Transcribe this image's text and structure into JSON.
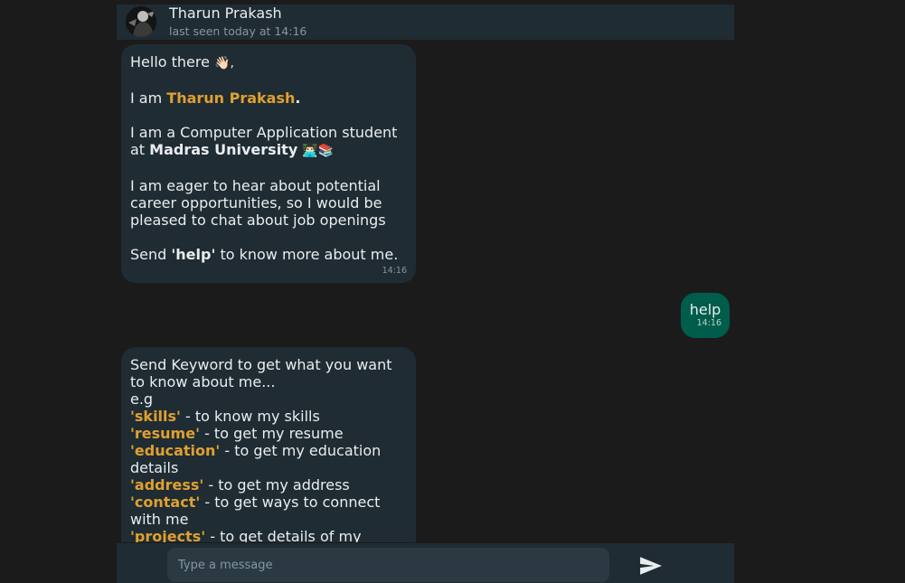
{
  "header": {
    "name": "Tharun Prakash",
    "status": "last seen today at 14:16"
  },
  "messages": {
    "intro": {
      "greeting": "Hello there",
      "greeting_emoji": "👋🏻,",
      "iam_prefix": "I am ",
      "iam_name": "Tharun Prakash",
      "iam_suffix": ".",
      "study_prefix": "I am a Computer Application student at ",
      "study_univ": "Madras University",
      "study_emoji": "👨🏻‍💻📚",
      "career": "I am eager to hear about potential career opportunities, so I would be pleased to chat about job openings",
      "help_prefix": "Send ",
      "help_keyword": "'help'",
      "help_suffix": " to know more about me.",
      "time": "14:16"
    },
    "outgoing": {
      "text": "help",
      "time": "14:16"
    },
    "keywords": {
      "intro": "Send Keyword to get what you want to know about me...",
      "eg": "e.g",
      "items": [
        {
          "kw": "'skills'",
          "desc": " - to know my skills"
        },
        {
          "kw": "'resume'",
          "desc": " - to get my resume"
        },
        {
          "kw": "'education'",
          "desc": " - to get my education details"
        },
        {
          "kw": "'address'",
          "desc": " - to get my address"
        },
        {
          "kw": "'contact'",
          "desc": " - to get ways to connect with me"
        },
        {
          "kw": "'projects'",
          "desc": " - to get details of my"
        }
      ]
    }
  },
  "composer": {
    "placeholder": "Type a message"
  },
  "icons": {
    "send": "send-icon",
    "avatar": "avatar"
  },
  "colors": {
    "background": "#1b1b1b",
    "panel": "#1f2c33",
    "outgoing": "#005c4b",
    "highlight": "#e0a030"
  }
}
